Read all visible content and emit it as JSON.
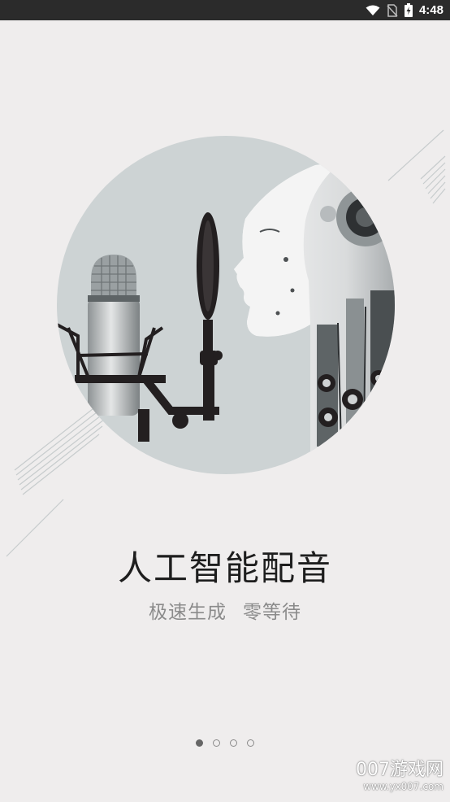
{
  "status_bar": {
    "time": "4:48",
    "icons": [
      "wifi-icon",
      "no-sim-icon",
      "battery-charging-icon"
    ]
  },
  "illustration": {
    "subjects": [
      "studio-microphone-icon",
      "pop-filter-icon",
      "robot-head-icon"
    ]
  },
  "onboarding": {
    "title": "人工智能配音",
    "subtitle_part1": "极速生成",
    "subtitle_part2": "零等待",
    "page_count": 4,
    "current_page": 1
  },
  "watermark": {
    "brand": "007游戏网",
    "url": "www.yx007.com"
  },
  "colors": {
    "background": "#efeded",
    "status_bar": "#2b2b2b",
    "circle": "#cdd3d4",
    "title": "#1e1e1e",
    "subtitle": "#8b8b8b"
  }
}
